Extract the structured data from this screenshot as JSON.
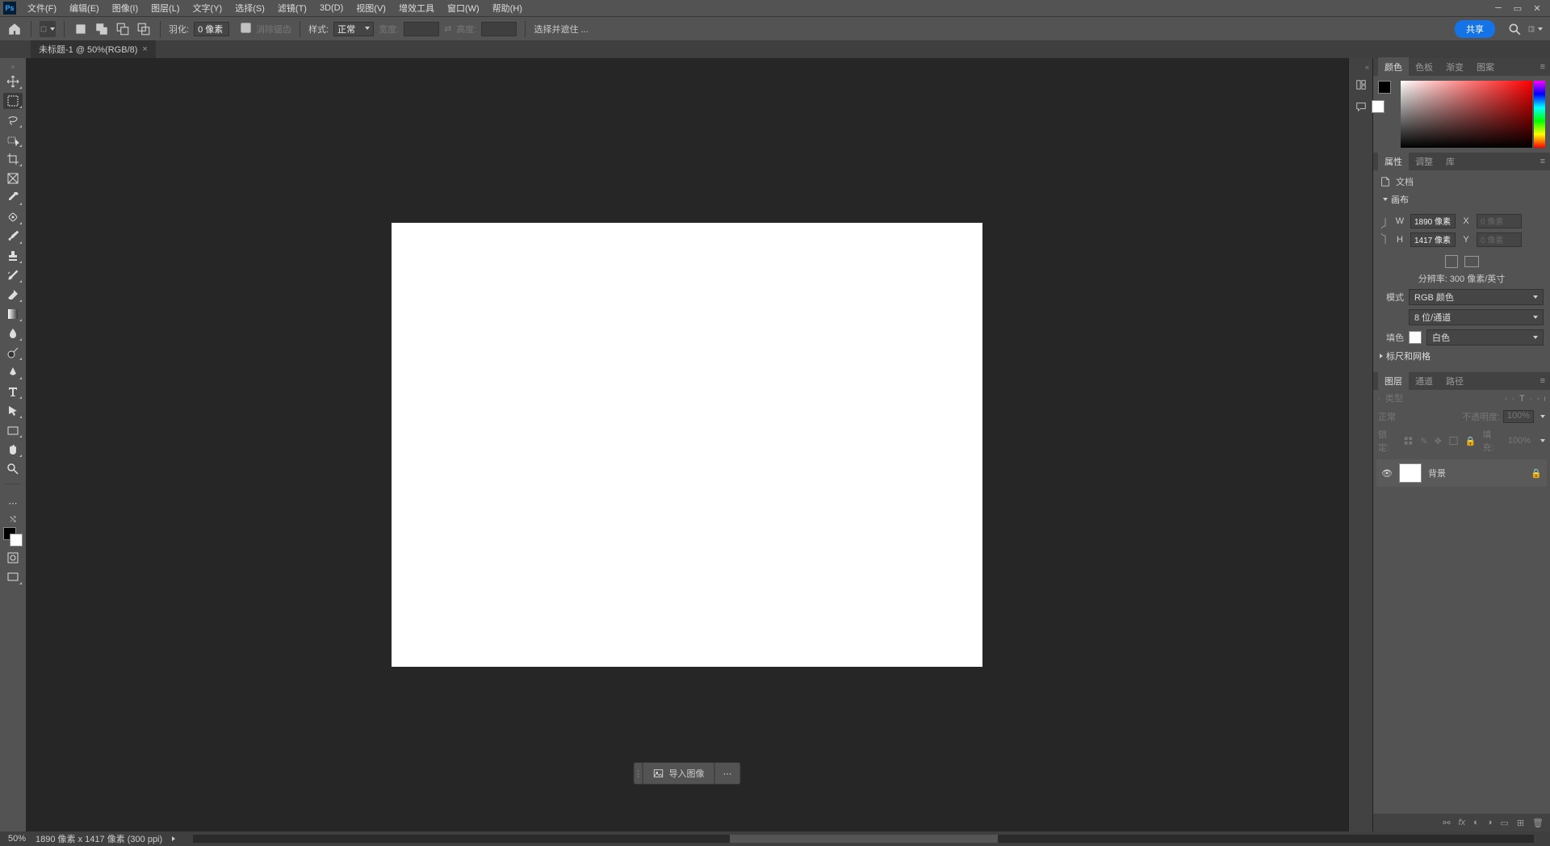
{
  "menu": {
    "file": "文件(F)",
    "edit": "编辑(E)",
    "image": "图像(I)",
    "layer": "图层(L)",
    "type": "文字(Y)",
    "select": "选择(S)",
    "filter": "滤镜(T)",
    "d3": "3D(D)",
    "view": "视图(V)",
    "enhance": "增效工具",
    "window": "窗口(W)",
    "help": "帮助(H)"
  },
  "options": {
    "featherLabel": "羽化:",
    "featherVal": "0 像素",
    "antialias": "消除锯齿",
    "styleLabel": "样式:",
    "styleVal": "正常",
    "widthLabel": "宽度:",
    "heightLabel": "高度:",
    "selectHold": "选择并遮住 ...",
    "share": "共享"
  },
  "tab": {
    "title": "未标题-1 @ 50%(RGB/8)"
  },
  "import": {
    "label": "导入图像"
  },
  "status": {
    "zoom": "50%",
    "dims": "1890 像素 x 1417 像素 (300 ppi)"
  },
  "panColor": {
    "tab1": "颜色",
    "tab2": "色板",
    "tab3": "渐变",
    "tab4": "图案"
  },
  "panProp": {
    "tab1": "属性",
    "tab2": "调整",
    "tab3": "库",
    "doc": "文档",
    "canvas": "画布",
    "w": "W",
    "wVal": "1890 像素",
    "x": "X",
    "xVal": "0 像素",
    "h": "H",
    "hVal": "1417 像素",
    "y": "Y",
    "yVal": "0 像素",
    "res": "分辨率: 300 像素/英寸",
    "modeLabel": "模式",
    "modeVal": "RGB 颜色",
    "depthVal": "8 位/通道",
    "fillLabel": "填色",
    "fillVal": "白色",
    "ruler": "标尺和网格"
  },
  "panLayer": {
    "tab1": "图层",
    "tab2": "通道",
    "tab3": "路径",
    "kind": "类型",
    "blend": "正常",
    "opacityLabel": "不透明度:",
    "opacityVal": "100%",
    "lockLabel": "锁定:",
    "fillLabel": "填充:",
    "fillVal": "100%",
    "bgName": "背景"
  }
}
